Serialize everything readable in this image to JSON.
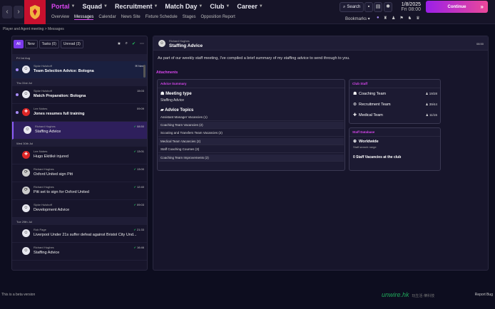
{
  "topbar": {
    "menu": [
      {
        "label": "Portal",
        "active": true
      },
      {
        "label": "Squad",
        "active": false
      },
      {
        "label": "Recruitment",
        "active": false
      },
      {
        "label": "Match Day",
        "active": false
      },
      {
        "label": "Club",
        "active": false
      },
      {
        "label": "Career",
        "active": false
      }
    ],
    "submenu": [
      {
        "label": "Overview"
      },
      {
        "label": "Messages",
        "active": true
      },
      {
        "label": "Calendar"
      },
      {
        "label": "News Site"
      },
      {
        "label": "Fixture Schedule"
      },
      {
        "label": "Stages"
      },
      {
        "label": "Opposition Report"
      }
    ],
    "search_label": "Search",
    "date_line1": "1/8/2025",
    "date_line2": "Fri",
    "time": "08:00",
    "continue_label": "Continue",
    "bookmarks_label": "Bookmarks"
  },
  "breadcrumb": "Player and Agent meeting > Messages",
  "filters": {
    "all": "All",
    "new": "New",
    "tasks": "Tasks (0)",
    "unread": "Unread (3)"
  },
  "inbox": [
    {
      "type": "day",
      "label": "Fri 1st Aug"
    },
    {
      "type": "msg",
      "sender": "Sipke Hulshoff",
      "subject": "Team Selection Advice: Bologna",
      "tag": "New",
      "unread": true,
      "bold": true,
      "avatar": "white",
      "highlight": true
    },
    {
      "type": "day",
      "label": "Thu 31st Jul"
    },
    {
      "type": "msg",
      "sender": "Sipke Hulshoff",
      "subject": "Match Preparation: Bologna",
      "time": "15:03",
      "unread": true,
      "bold": true,
      "avatar": "white"
    },
    {
      "type": "msg",
      "sender": "Lee Nobes",
      "subject": "Jones resumes full training",
      "time": "09:09",
      "unread": true,
      "bold": true,
      "avatar": "red"
    },
    {
      "type": "msg",
      "sender": "Richard Hughes",
      "subject": "Staffing Advice",
      "time": "08:50",
      "tick": true,
      "selected": true,
      "avatar": "white"
    },
    {
      "type": "day",
      "label": "Wed 30th Jul"
    },
    {
      "type": "msg",
      "sender": "Lee Nobes",
      "subject": "Hugo Ekitiké injured",
      "time": "13:01",
      "tick": true,
      "avatar": "red"
    },
    {
      "type": "msg",
      "sender": "Richard Hughes",
      "subject": "Oxford United sign Pitt",
      "time": "13:00",
      "tick": true,
      "avatar": "dark"
    },
    {
      "type": "msg",
      "sender": "Richard Hughes",
      "subject": "Pitt set to sign for Oxford United",
      "time": "12:40",
      "tick": true,
      "avatar": "dark"
    },
    {
      "type": "msg",
      "sender": "Sipke Hulshoff",
      "subject": "Development Advice",
      "time": "09:03",
      "tick": true,
      "avatar": "white"
    },
    {
      "type": "day",
      "label": "Tue 29th Jul"
    },
    {
      "type": "msg",
      "sender": "Rob Page",
      "subject": "Liverpool Under 21s suffer defeat against Bristol City Und...",
      "time": "21:33",
      "tick": true,
      "avatar": "white"
    },
    {
      "type": "msg",
      "sender": "Richard Hughes",
      "subject": "Staffing Advice",
      "time": "16:46",
      "tick": true,
      "avatar": "white"
    }
  ],
  "message": {
    "from": "Richard Hughes",
    "title": "Staffing Advice",
    "time": "08:50",
    "body": "As part of our weekly staff meeting, I've compiled a brief summary of my staffing advice to send through to you.",
    "attachments_label": "Attachments",
    "advice": {
      "title": "Advice Summary",
      "meeting_type_label": "Meeting type",
      "meeting_type_value": "Staffing Advice",
      "topics_label": "Advice Topics",
      "topics": [
        "Assistant Manager Vacancies (1)",
        "Coaching Team Vacancies (2)",
        "Scouting and Transfers Team Vacancies (2)",
        "Medical Team Vacancies (2)",
        "Staff Coaching Courses (3)",
        "Coaching Team Improvements (2)"
      ]
    },
    "club_staff": {
      "title": "Club Staff",
      "rows": [
        {
          "label": "Coaching Team",
          "value": "19/28"
        },
        {
          "label": "Recruitment Team",
          "value": "39/44"
        },
        {
          "label": "Medical Team",
          "value": "11/15"
        }
      ]
    },
    "staff_db": {
      "title": "Staff Database",
      "region": "Worldwide",
      "region_sub": "Staff search range",
      "vacancies": "0 Staff Vacancies at the club"
    }
  },
  "footer": "This is a beta version",
  "report": "Report Bug",
  "watermark": "unwire.hk",
  "watermark_sub": "玩生活·樂科技",
  "colors": {
    "accent": "#d946ef",
    "selected": "#2e1f5c",
    "bg": "#0d0d1f"
  }
}
